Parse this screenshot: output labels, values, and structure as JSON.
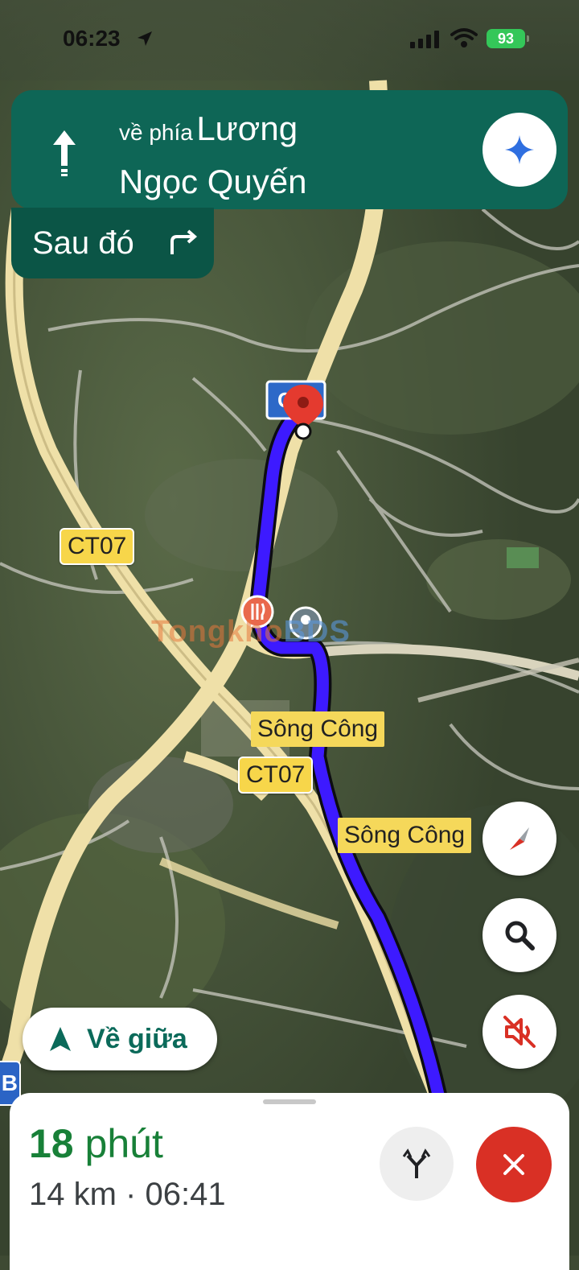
{
  "status_bar": {
    "time": "06:23",
    "battery": "93"
  },
  "banner": {
    "prefix": "về phía",
    "street_line1": "Lương",
    "street_line2": "Ngọc Quyến",
    "then_label": "Sau đó"
  },
  "map": {
    "road_labels": [
      "CT07",
      "CT07"
    ],
    "place_labels": [
      "Sông Công",
      "Sông Công"
    ],
    "route_color": "#3d1aff",
    "watermark": {
      "part1": "Tongkho",
      "part2": "BDS"
    }
  },
  "controls": {
    "recenter_label": "Về giữa",
    "side_tab_label": "B"
  },
  "trip": {
    "duration_value": "18",
    "duration_unit": "phút",
    "summary": "14 km · 06:41"
  },
  "colors": {
    "banner": "#0e6656",
    "eta_green": "#188038",
    "close_red": "#d93025"
  }
}
